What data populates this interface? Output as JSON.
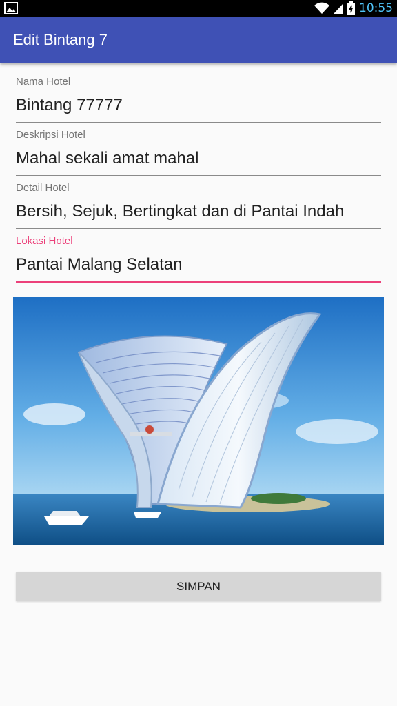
{
  "status_bar": {
    "time": "10:55"
  },
  "app_bar": {
    "title": "Edit Bintang 7"
  },
  "form": {
    "fields": [
      {
        "label": "Nama Hotel",
        "value": "Bintang 77777",
        "focused": false
      },
      {
        "label": "Deskripsi Hotel",
        "value": "Mahal sekali amat mahal",
        "focused": false
      },
      {
        "label": "Detail Hotel",
        "value": "Bersih, Sejuk, Bertingkat dan di Pantai Indah",
        "focused": false
      },
      {
        "label": "Lokasi Hotel",
        "value": "Pantai Malang Selatan",
        "focused": true
      }
    ],
    "accent_color": "#ec407a"
  },
  "image": {
    "subject": "hotel-photo"
  },
  "actions": {
    "save_label": "SIMPAN"
  },
  "colors": {
    "primary": "#3f51b5",
    "background": "#fafafa"
  }
}
